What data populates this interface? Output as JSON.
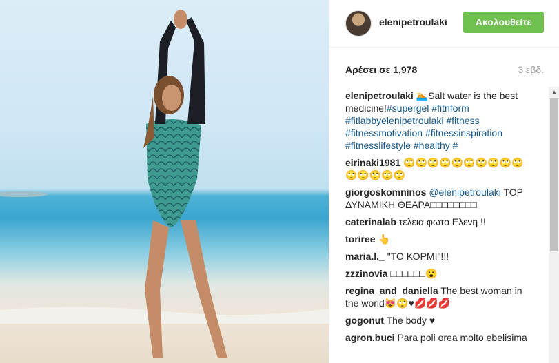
{
  "header": {
    "username": "elenipetroulaki",
    "follow_label": "Ακολουθείτε"
  },
  "stats": {
    "likes": "Αρέσει σε 1,978",
    "time": "3 εβδ."
  },
  "caption": {
    "user": "elenipetroulaki",
    "emoji": "🏊",
    "text": "Salt water is the best medicine!",
    "tags": "#supergel #fitnform #fitlabbyelenipetroulaki #fitness #fitnessmotivation #fitnessinspiration #fitnesslifestyle #healthy #"
  },
  "comments": [
    {
      "user": "eirinaki1981",
      "text": "🙄🙄🙄🙄🙄🙄🙄🙄🙄🙄🙄🙄🙄🙄🙄"
    },
    {
      "user": "giorgoskomninos",
      "mention": "@elenipetroulaki",
      "text": "TOP ΔΥΝΑΜΙΚΗ ΘΕΑΡΑ□□□□□□□□"
    },
    {
      "user": "caterinalab",
      "text": "τελεια φωτο Ελενη !!"
    },
    {
      "user": "toriree",
      "text": "👆"
    },
    {
      "user": "maria.l._",
      "text": "\"ΤΟ ΚΟΡΜΙ\"!!!"
    },
    {
      "user": "zzzinovia",
      "text": "□□□□□□😮"
    },
    {
      "user": "regina_and_daniella",
      "text": "The best woman in the world😻🙄♥💋💋💋"
    },
    {
      "user": "gogonut",
      "text": "The body ♥"
    },
    {
      "user": "agron.buci",
      "text": "Para poli orea molto ebelisima"
    }
  ],
  "icons": {
    "avatar": "profile-avatar",
    "scroll_up": "▲"
  },
  "colors": {
    "follow_button": "#70c050",
    "hashtag": "#125688"
  }
}
